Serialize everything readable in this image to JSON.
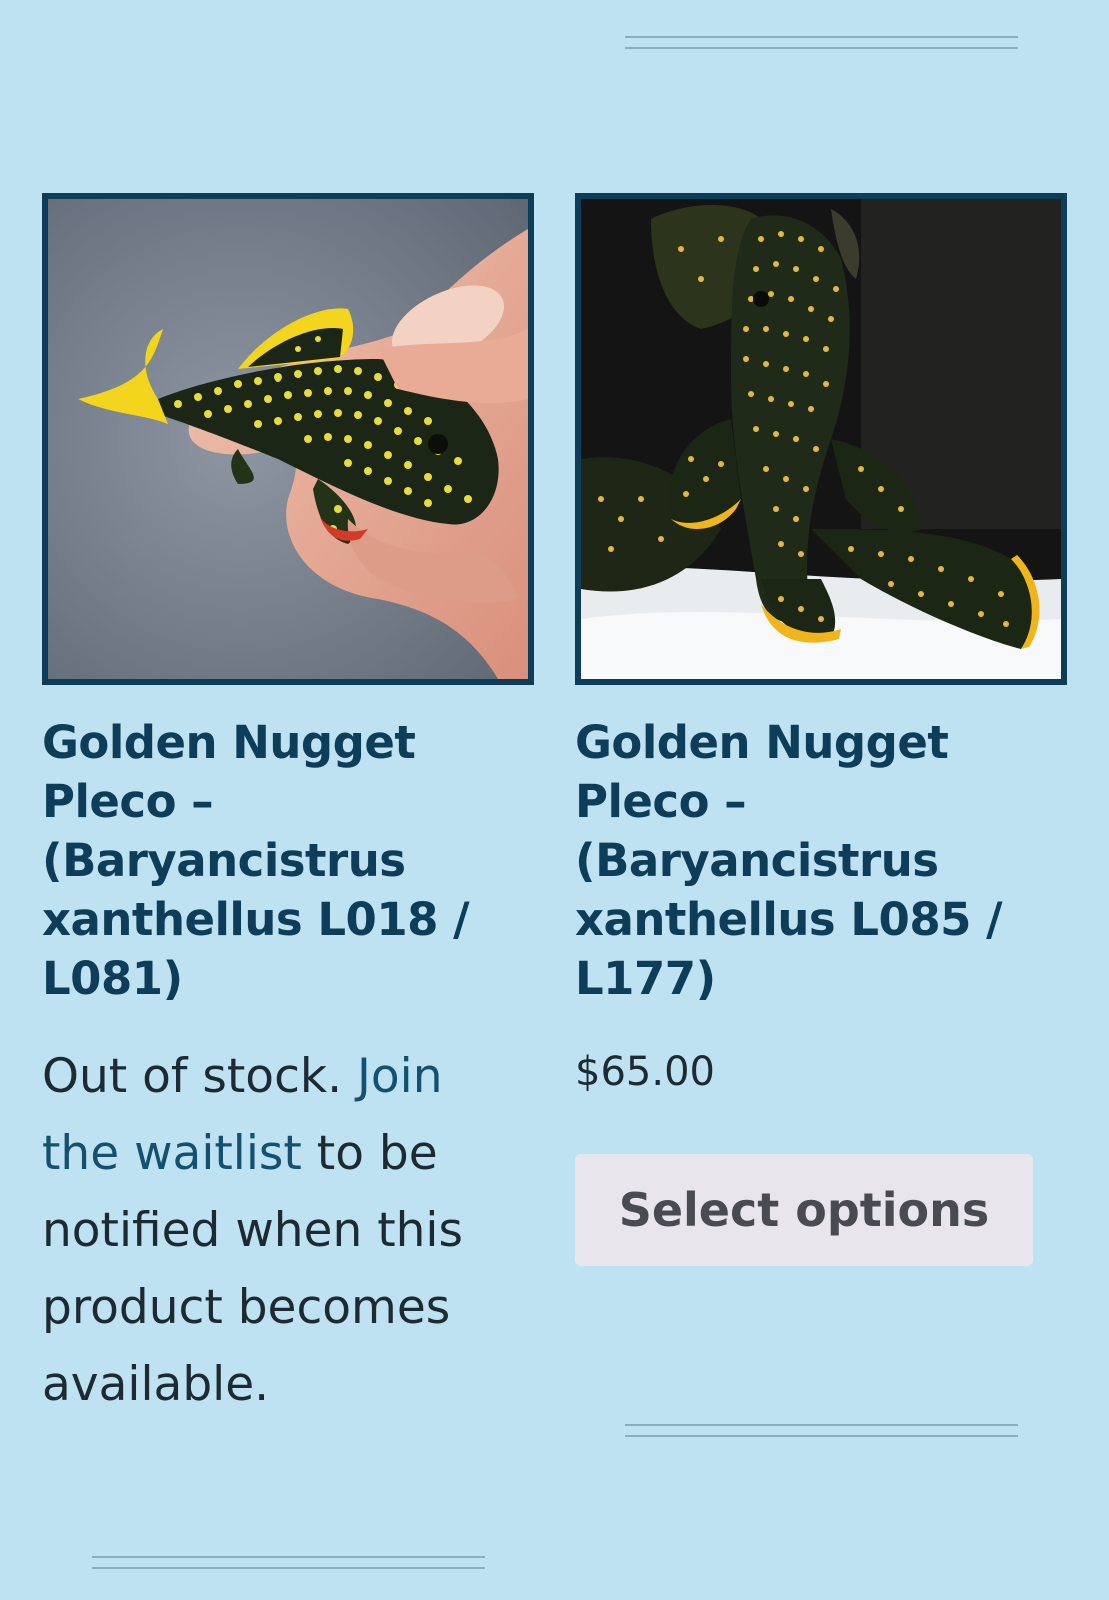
{
  "products": [
    {
      "title": "Golden Nugget Pleco – (Baryancistrus xanthellus L018 / L081)",
      "image_alt": "golden-nugget-pleco-in-hand",
      "stock_prefix": "Out of stock.",
      "waitlist_link": "Join the waitlist",
      "stock_suffix": "to be notified when this product becomes available."
    },
    {
      "title": "Golden Nugget Pleco – (Baryancistrus xanthellus L085 / L177)",
      "image_alt": "golden-nugget-pleco-in-tank",
      "price": "$65.00",
      "button_label": "Select options"
    }
  ],
  "colors": {
    "background": "#bee2f1",
    "title": "#0d3d58",
    "link": "#14506f",
    "button_bg": "#e8e6ec",
    "divider": "#8eaebf"
  }
}
